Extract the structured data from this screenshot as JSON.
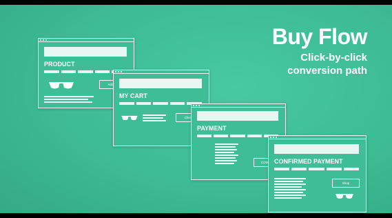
{
  "headline": {
    "title": "Buy Flow",
    "subtitle_line1": "Click-by-click",
    "subtitle_line2": "conversion path"
  },
  "screens": [
    {
      "heading": "PRODUCT",
      "button": "Add to"
    },
    {
      "heading": "MY CART",
      "button": "Check"
    },
    {
      "heading": "PAYMENT",
      "button": "COMPL"
    },
    {
      "heading": "CONFIRMED PAYMENT",
      "button": "Shop"
    }
  ],
  "icons": [
    "glasses-icon"
  ],
  "colors": {
    "background": "#3dbb93",
    "foreground": "#ffffff"
  }
}
